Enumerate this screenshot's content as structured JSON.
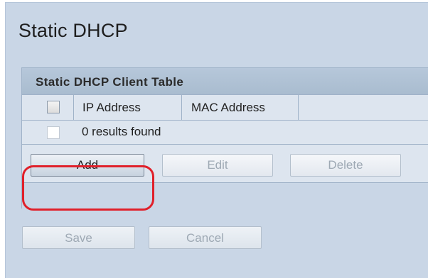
{
  "page": {
    "title": "Static DHCP"
  },
  "client_table": {
    "title": "Static DHCP Client Table",
    "columns": [
      "IP Address",
      "MAC Address"
    ],
    "empty_message": "0 results found"
  },
  "table_buttons": {
    "add_label": "Add",
    "edit_label": "Edit",
    "delete_label": "Delete"
  },
  "form_buttons": {
    "save_label": "Save",
    "cancel_label": "Cancel"
  },
  "colors": {
    "highlight": "#e0202a",
    "panel_background": "#c9d6e6",
    "table_header": "#b6c7da"
  }
}
